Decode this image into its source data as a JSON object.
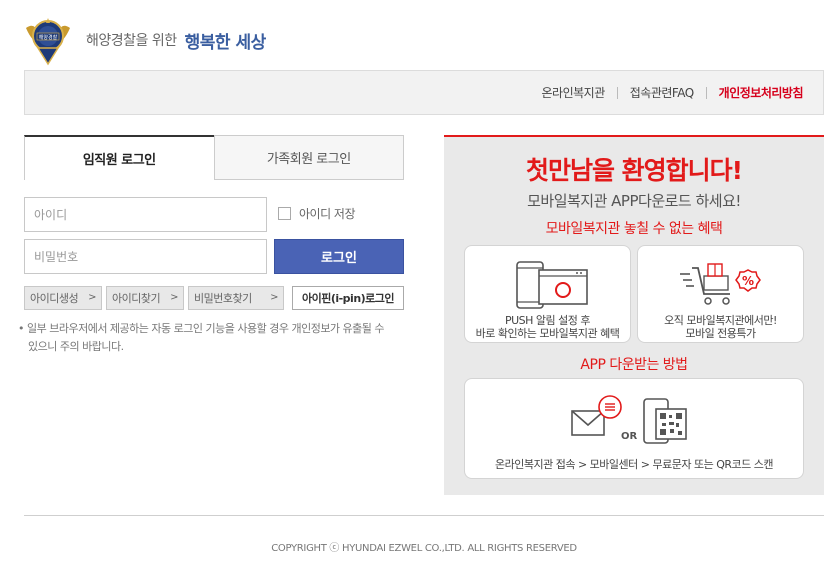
{
  "header": {
    "tagline": "해양경찰을 위한",
    "tagline_strong": "행복한 세상",
    "emblem_text": "해양경찰"
  },
  "topnav": {
    "items": [
      "온라인복지관",
      "접속관련FAQ",
      "개인정보처리방침"
    ]
  },
  "login": {
    "tabs": [
      "임직원 로그인",
      "가족회원 로그인"
    ],
    "id_placeholder": "아이디",
    "pw_placeholder": "비밀번호",
    "save_id_label": "아이디 저장",
    "login_label": "로그인",
    "links": [
      "아이디생성",
      "아이디찾기",
      "비밀번호찾기"
    ],
    "ipin_label": "아이핀(i-pin)로그인",
    "notice_line1": "• 일부 브라우저에서 제공하는 자동 로그인 기능을 사용할 경우 개인정보가 유출될 수",
    "notice_line2": "있으니 주의 바랍니다."
  },
  "promo": {
    "title": "첫만남을 환영합니다!",
    "subtitle": "모바일복지관 APP다운로드 하세요!",
    "benefit_title": "모바일복지관 놓칠 수 없는 혜택",
    "card1_line1": "PUSH 알림 설정 후",
    "card1_line2": "바로 확인하는 모바일복지관 혜택",
    "card2_line1": "오직 모바일복지관에서만!",
    "card2_line2": "모바일 전용특가",
    "how_title": "APP 다운받는 방법",
    "or_label": "OR",
    "how_text": "온라인복지관 접속 > 모바일센터 > 무료문자 또는 QR코드 스캔",
    "percent": "%"
  },
  "footer": {
    "copyright": "COPYRIGHT ⓒ HYUNDAI EZWEL CO.,LTD. ALL RIGHTS RESERVED"
  },
  "colors": {
    "accent_red": "#e21a1a",
    "login_blue": "#4a63b5",
    "brand_blue": "#3a5ea0"
  }
}
